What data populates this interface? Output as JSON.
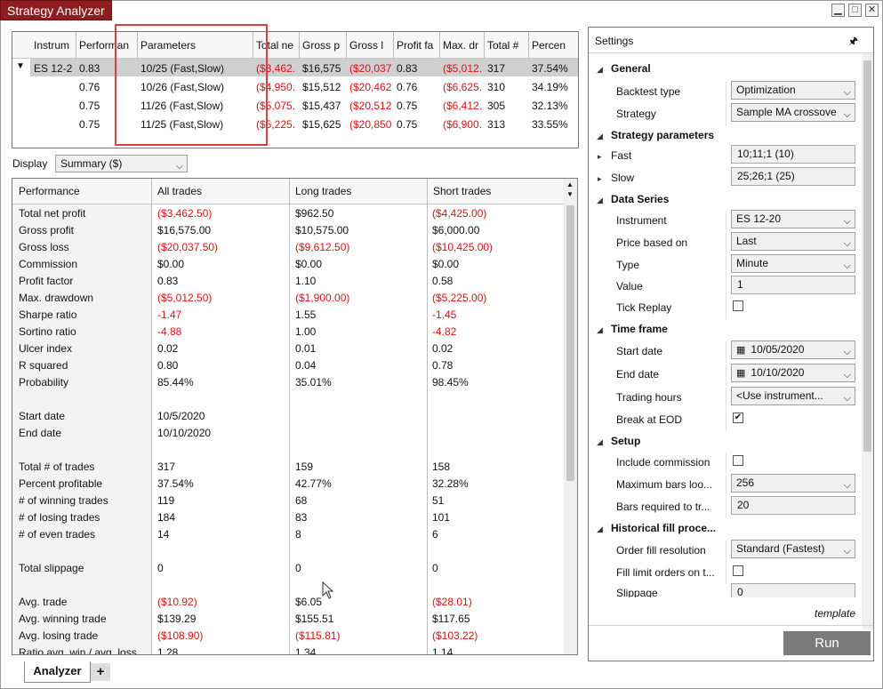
{
  "window": {
    "title": "Strategy Analyzer",
    "minimize_icon": "minimize-icon",
    "maximize_icon": "maximize-icon",
    "close_icon": "close-icon"
  },
  "optimization_grid": {
    "columns": [
      "Instrum",
      "Performan",
      "Parameters",
      "Total ne",
      "Gross p",
      "Gross l",
      "Profit fa",
      "Max. dr",
      "Total # ",
      "Percen"
    ],
    "rows": [
      {
        "instrument": "ES 12-2",
        "performance": "0.83",
        "parameters": "10/25 (Fast,Slow)",
        "total_net": "($3,462.",
        "gross_profit": "$16,575",
        "gross_loss": "($20,037",
        "profit_factor": "0.83",
        "max_dd": "($5,012.",
        "total_trades": "317",
        "percent": "37.54%"
      },
      {
        "instrument": "",
        "performance": "0.76",
        "parameters": "10/26 (Fast,Slow)",
        "total_net": "($4,950.",
        "gross_profit": "$15,512",
        "gross_loss": "($20,462",
        "profit_factor": "0.76",
        "max_dd": "($6,625.",
        "total_trades": "310",
        "percent": "34.19%"
      },
      {
        "instrument": "",
        "performance": "0.75",
        "parameters": "11/26 (Fast,Slow)",
        "total_net": "($5,075.",
        "gross_profit": "$15,437",
        "gross_loss": "($20,512",
        "profit_factor": "0.75",
        "max_dd": "($6,412.",
        "total_trades": "305",
        "percent": "32.13%"
      },
      {
        "instrument": "",
        "performance": "0.75",
        "parameters": "11/25 (Fast,Slow)",
        "total_net": "($5,225.",
        "gross_profit": "$15,625",
        "gross_loss": "($20,850",
        "profit_factor": "0.75",
        "max_dd": "($6,900.",
        "total_trades": "313",
        "percent": "33.55%"
      }
    ]
  },
  "display": {
    "label": "Display",
    "value": "Summary ($)"
  },
  "summary": {
    "headers": [
      "Performance",
      "All trades",
      "Long trades",
      "Short trades"
    ],
    "rows": [
      {
        "label": "Total net profit",
        "all": "($3,462.50)",
        "all_red": true,
        "long": "$962.50",
        "long_red": false,
        "short": "($4,425.00)",
        "short_red": true
      },
      {
        "label": "Gross profit",
        "all": "$16,575.00",
        "all_red": false,
        "long": "$10,575.00",
        "long_red": false,
        "short": "$6,000.00",
        "short_red": false
      },
      {
        "label": "Gross loss",
        "all": "($20,037.50)",
        "all_red": true,
        "long": "($9,612.50)",
        "long_red": true,
        "short": "($10,425.00)",
        "short_red": true
      },
      {
        "label": "Commission",
        "all": "$0.00",
        "all_red": false,
        "long": "$0.00",
        "long_red": false,
        "short": "$0.00",
        "short_red": false
      },
      {
        "label": "Profit factor",
        "all": "0.83",
        "all_red": false,
        "long": "1.10",
        "long_red": false,
        "short": "0.58",
        "short_red": false
      },
      {
        "label": "Max. drawdown",
        "all": "($5,012.50)",
        "all_red": true,
        "long": "($1,900.00)",
        "long_red": true,
        "short": "($5,225.00)",
        "short_red": true
      },
      {
        "label": "Sharpe ratio",
        "all": "-1.47",
        "all_red": true,
        "long": "1.55",
        "long_red": false,
        "short": "-1.45",
        "short_red": true
      },
      {
        "label": "Sortino ratio",
        "all": "-4.88",
        "all_red": true,
        "long": "1.00",
        "long_red": false,
        "short": "-4.82",
        "short_red": true
      },
      {
        "label": "Ulcer index",
        "all": "0.02",
        "all_red": false,
        "long": "0.01",
        "long_red": false,
        "short": "0.02",
        "short_red": false
      },
      {
        "label": "R squared",
        "all": "0.80",
        "all_red": false,
        "long": "0.04",
        "long_red": false,
        "short": "0.78",
        "short_red": false
      },
      {
        "label": "Probability",
        "all": "85.44%",
        "all_red": false,
        "long": "35.01%",
        "long_red": false,
        "short": "98.45%",
        "short_red": false
      },
      {
        "label": "",
        "all": "",
        "all_red": false,
        "long": "",
        "long_red": false,
        "short": "",
        "short_red": false
      },
      {
        "label": "Start date",
        "all": "10/5/2020",
        "all_red": false,
        "long": "",
        "long_red": false,
        "short": "",
        "short_red": false
      },
      {
        "label": "End date",
        "all": "10/10/2020",
        "all_red": false,
        "long": "",
        "long_red": false,
        "short": "",
        "short_red": false
      },
      {
        "label": "",
        "all": "",
        "all_red": false,
        "long": "",
        "long_red": false,
        "short": "",
        "short_red": false
      },
      {
        "label": "Total # of trades",
        "all": "317",
        "all_red": false,
        "long": "159",
        "long_red": false,
        "short": "158",
        "short_red": false
      },
      {
        "label": "Percent profitable",
        "all": "37.54%",
        "all_red": false,
        "long": "42.77%",
        "long_red": false,
        "short": "32.28%",
        "short_red": false
      },
      {
        "label": "# of winning trades",
        "all": "119",
        "all_red": false,
        "long": "68",
        "long_red": false,
        "short": "51",
        "short_red": false
      },
      {
        "label": "# of losing trades",
        "all": "184",
        "all_red": false,
        "long": "83",
        "long_red": false,
        "short": "101",
        "short_red": false
      },
      {
        "label": "# of even trades",
        "all": "14",
        "all_red": false,
        "long": "8",
        "long_red": false,
        "short": "6",
        "short_red": false
      },
      {
        "label": "",
        "all": "",
        "all_red": false,
        "long": "",
        "long_red": false,
        "short": "",
        "short_red": false
      },
      {
        "label": "Total slippage",
        "all": "0",
        "all_red": false,
        "long": "0",
        "long_red": false,
        "short": "0",
        "short_red": false
      },
      {
        "label": "",
        "all": "",
        "all_red": false,
        "long": "",
        "long_red": false,
        "short": "",
        "short_red": false
      },
      {
        "label": "Avg. trade",
        "all": "($10.92)",
        "all_red": true,
        "long": "$6.05",
        "long_red": false,
        "short": "($28.01)",
        "short_red": true
      },
      {
        "label": "Avg. winning trade",
        "all": "$139.29",
        "all_red": false,
        "long": "$155.51",
        "long_red": false,
        "short": "$117.65",
        "short_red": false
      },
      {
        "label": "Avg. losing trade",
        "all": "($108.90)",
        "all_red": true,
        "long": "($115.81)",
        "long_red": true,
        "short": "($103.22)",
        "short_red": true
      },
      {
        "label": "Ratio avg. win / avg. loss",
        "all": "1.28",
        "all_red": false,
        "long": "1.34",
        "long_red": false,
        "short": "1.14",
        "short_red": false
      }
    ]
  },
  "settings": {
    "title": "Settings",
    "sections": {
      "general": "General",
      "strategy_parameters": "Strategy parameters",
      "data_series": "Data Series",
      "time_frame": "Time frame",
      "setup": "Setup",
      "historical_fill": "Historical fill proce..."
    },
    "fields": {
      "backtest_type_label": "Backtest type",
      "backtest_type_value": "Optimization",
      "strategy_label": "Strategy",
      "strategy_value": "Sample MA crossove",
      "fast_label": "Fast",
      "fast_value": "10;11;1 (10)",
      "slow_label": "Slow",
      "slow_value": "25;26;1 (25)",
      "instrument_label": "Instrument",
      "instrument_value": "ES 12-20",
      "price_based_on_label": "Price based on",
      "price_based_on_value": "Last",
      "type_label": "Type",
      "type_value": "Minute",
      "value_label": "Value",
      "value_value": "1",
      "tick_replay_label": "Tick Replay",
      "tick_replay_checked": false,
      "start_date_label": "Start date",
      "start_date_value": "10/05/2020",
      "end_date_label": "End date",
      "end_date_value": "10/10/2020",
      "trading_hours_label": "Trading hours",
      "trading_hours_value": "<Use instrument...",
      "break_eod_label": "Break at EOD",
      "break_eod_checked": true,
      "include_commission_label": "Include commission",
      "include_commission_checked": false,
      "max_bars_label": "Maximum bars loo...",
      "max_bars_value": "256",
      "bars_required_label": "Bars required to tr...",
      "bars_required_value": "20",
      "order_fill_label": "Order fill resolution",
      "order_fill_value": "Standard (Fastest)",
      "fill_limit_label": "Fill limit orders on t...",
      "fill_limit_checked": false,
      "slippage_label": "Slippage",
      "slippage_value": "0"
    },
    "template_label": "template",
    "run_label": "Run"
  },
  "tabs": {
    "analyzer": "Analyzer",
    "add": "+"
  }
}
